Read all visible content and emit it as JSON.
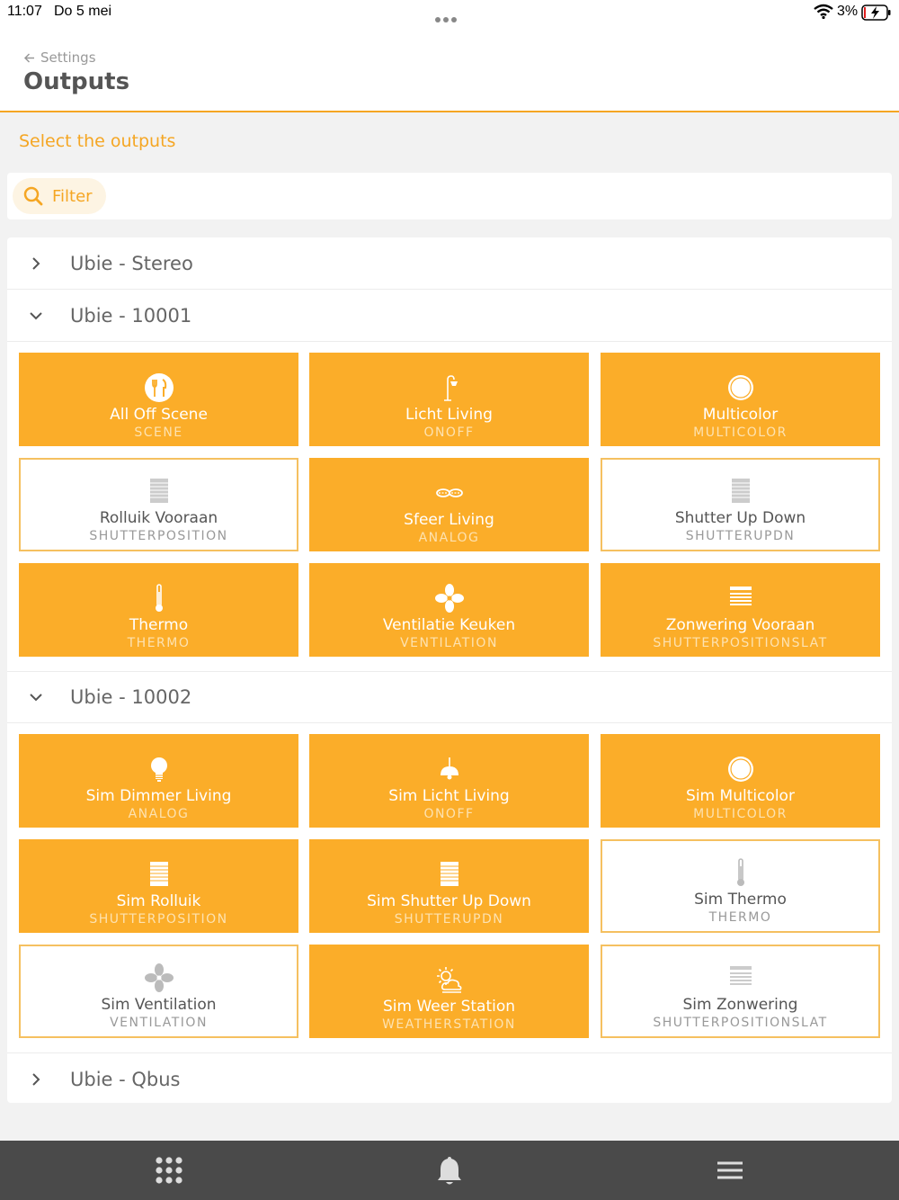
{
  "status_bar": {
    "time": "11:07",
    "date": "Do 5 mei",
    "battery": "3%"
  },
  "header": {
    "back_label": "Settings",
    "title": "Outputs"
  },
  "hint": "Select the outputs",
  "filter": {
    "label": "Filter"
  },
  "groups": [
    {
      "title": "Ubie - Stereo",
      "expanded": false
    },
    {
      "title": "Ubie - 10001",
      "expanded": true
    },
    {
      "title": "Ubie - 10002",
      "expanded": true
    },
    {
      "title": "Ubie - Qbus",
      "expanded": false
    }
  ],
  "tiles": [
    {
      "name": "All Off Scene",
      "type": "SCENE",
      "selected": true,
      "icon": "scene-icon"
    },
    {
      "name": "Licht Living",
      "type": "ONOFF",
      "selected": true,
      "icon": "lamp-icon"
    },
    {
      "name": "Multicolor",
      "type": "MULTICOLOR",
      "selected": true,
      "icon": "circle-icon"
    },
    {
      "name": "Rolluik Vooraan",
      "type": "SHUTTERPOSITION",
      "selected": false,
      "icon": "shutter-icon"
    },
    {
      "name": "Sfeer Living",
      "type": "ANALOG",
      "selected": true,
      "icon": "spotlights-icon"
    },
    {
      "name": "Shutter Up Down",
      "type": "SHUTTERUPDN",
      "selected": false,
      "icon": "shutter-icon"
    },
    {
      "name": "Thermo",
      "type": "THERMO",
      "selected": true,
      "icon": "thermometer-icon"
    },
    {
      "name": "Ventilatie Keuken",
      "type": "VENTILATION",
      "selected": true,
      "icon": "fan-icon"
    },
    {
      "name": "Zonwering Vooraan",
      "type": "SHUTTERPOSITIONSLAT",
      "selected": true,
      "icon": "blinds-icon"
    },
    {
      "name": "Sim Dimmer Living",
      "type": "ANALOG",
      "selected": true,
      "icon": "bulb-icon"
    },
    {
      "name": "Sim Licht Living",
      "type": "ONOFF",
      "selected": true,
      "icon": "ceiling-lamp-icon"
    },
    {
      "name": "Sim Multicolor",
      "type": "MULTICOLOR",
      "selected": true,
      "icon": "circle-icon"
    },
    {
      "name": "Sim Rolluik",
      "type": "SHUTTERPOSITION",
      "selected": true,
      "icon": "shutter-icon"
    },
    {
      "name": "Sim Shutter Up Down",
      "type": "SHUTTERUPDN",
      "selected": true,
      "icon": "shutter-icon"
    },
    {
      "name": "Sim Thermo",
      "type": "THERMO",
      "selected": false,
      "icon": "thermometer-icon"
    },
    {
      "name": "Sim Ventilation",
      "type": "VENTILATION",
      "selected": false,
      "icon": "fan-icon"
    },
    {
      "name": "Sim Weer Station",
      "type": "WEATHERSTATION",
      "selected": true,
      "icon": "weather-icon"
    },
    {
      "name": "Sim Zonwering",
      "type": "SHUTTERPOSITIONSLAT",
      "selected": false,
      "icon": "blinds-icon"
    }
  ],
  "bottom_nav": [
    {
      "icon": "grid-icon"
    },
    {
      "icon": "bell-icon"
    },
    {
      "icon": "menu-icon"
    }
  ],
  "colors": {
    "accent": "#f5a623",
    "tile_on": "#fbad29",
    "bar": "#4a4a4a"
  }
}
